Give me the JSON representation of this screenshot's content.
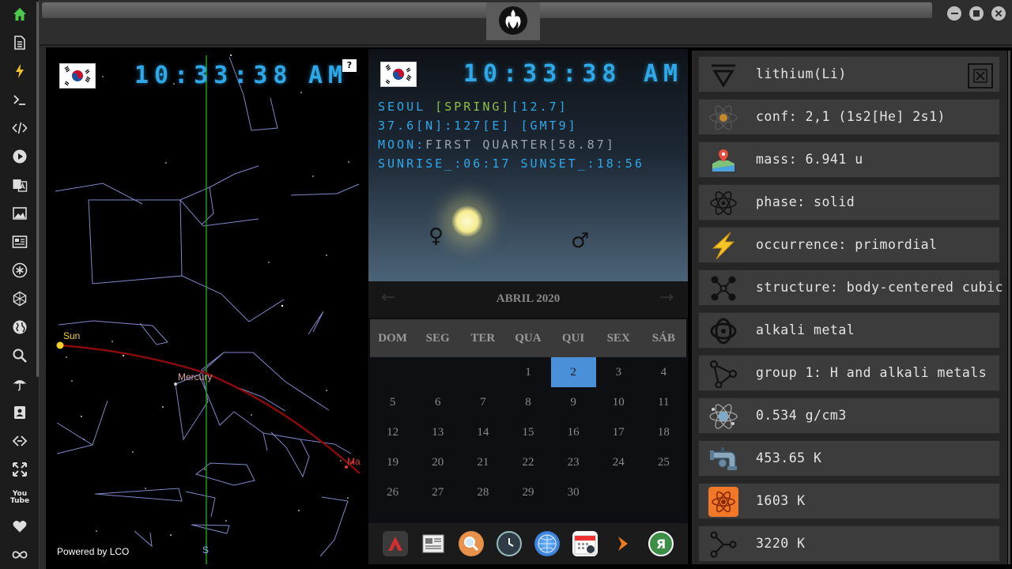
{
  "sidebar": {
    "icons": [
      "home-icon",
      "document-icon",
      "lightning-icon",
      "terminal-icon",
      "code-icon",
      "play-icon",
      "translate-icon",
      "image-icon",
      "news-icon",
      "asterisk-icon",
      "hexagon-icon",
      "globe-icon",
      "search-icon",
      "umbrella-icon",
      "contact-icon",
      "link-icon",
      "expand-icon",
      "youtube-icon",
      "heart-icon",
      "infinity-icon"
    ],
    "youtube_label": "You Tube"
  },
  "left_panel": {
    "clock": "10:33:38",
    "ampm": "AM",
    "help": "?",
    "powered_by": "Powered by LCO",
    "sky_labels": {
      "sun": "Sun",
      "mercury": "Mercury",
      "mars": "Ma",
      "south": "S"
    }
  },
  "center_panel": {
    "clock": "10:33:38",
    "ampm": "AM",
    "city": "SEOUL",
    "season": "[SPRING]",
    "temp": "[12.7]",
    "coords": "37.6[N]:127[E] [GMT9]",
    "moon_label": "MOON:",
    "moon_phase": "FIRST QUARTER[58.87]",
    "sun_times": "SUNRISE_:06:17 SUNSET_:18:56",
    "venus_symbol": "♀",
    "mars_symbol": "♂",
    "calendar": {
      "title": "ABRIL 2020",
      "prev": "←",
      "next": "→",
      "days": [
        "DOM",
        "SEG",
        "TER",
        "QUA",
        "QUI",
        "SEX",
        "SÁB"
      ],
      "weeks": [
        [
          "",
          "",
          "",
          "1",
          "2",
          "3",
          "4"
        ],
        [
          "5",
          "6",
          "7",
          "8",
          "9",
          "10",
          "11"
        ],
        [
          "12",
          "13",
          "14",
          "15",
          "16",
          "17",
          "18"
        ],
        [
          "19",
          "20",
          "21",
          "22",
          "23",
          "24",
          "25"
        ],
        [
          "26",
          "27",
          "28",
          "29",
          "30",
          "",
          ""
        ]
      ],
      "today": "2"
    },
    "dock": [
      "arch-icon",
      "newspaper-icon",
      "search-app-icon",
      "clock-app-icon",
      "globe-app-icon",
      "calendar-app-icon",
      "play-arrow-icon",
      "yandex-icon"
    ],
    "dock_labels": {
      "yandex": "Я"
    }
  },
  "right_panel": {
    "rows": [
      {
        "icon": "lithium-symbol-icon",
        "text": "lithium(Li)"
      },
      {
        "icon": "atom-config-icon",
        "text": "conf: 2,1 (1s2[He] 2s1)"
      },
      {
        "icon": "map-pin-icon",
        "text": "mass: 6.941 u"
      },
      {
        "icon": "atom-phase-icon",
        "text": "phase: solid"
      },
      {
        "icon": "lightning-occurrence-icon",
        "text": "occurrence: primordial"
      },
      {
        "icon": "molecule-structure-icon",
        "text": "structure: body-centered cubic"
      },
      {
        "icon": "atom-ring-icon",
        "text": "alkali metal"
      },
      {
        "icon": "group-graph-icon",
        "text": "group 1: H and alkali metals"
      },
      {
        "icon": "density-atom-icon",
        "text": "0.534 g/cm3"
      },
      {
        "icon": "melting-pipe-icon",
        "text": "453.65 K"
      },
      {
        "icon": "boiling-atom-icon",
        "text": "1603 K"
      },
      {
        "icon": "nodes-icon",
        "text": "3220 K"
      }
    ]
  },
  "colors": {
    "accent_blue": "#2ea8e8",
    "today_blue": "#4a90d9",
    "season_green": "#8fbf49",
    "ecliptic_red": "#8b0a0a",
    "sun_yellow": "#f4d12a"
  }
}
